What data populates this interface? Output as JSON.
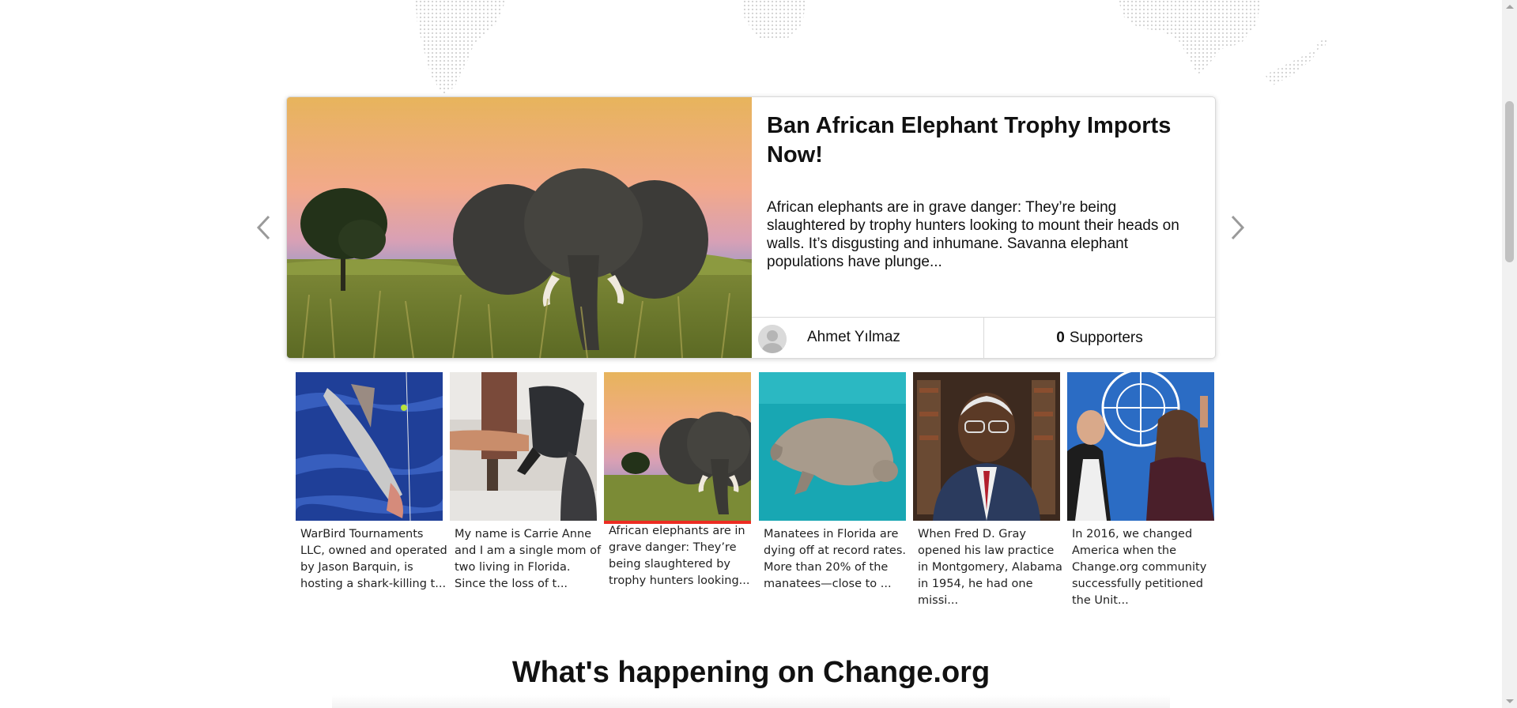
{
  "featured": {
    "title": "Ban African Elephant Trophy Imports Now!",
    "description": "African elephants are in grave danger: They’re being slaughtered by trophy hunters looking to mount their heads on walls. It’s disgusting and inhumane. Savanna elephant populations have plunge...",
    "author": "Ahmet Yılmaz",
    "supporters_count": "0",
    "supporters_label": "Supporters"
  },
  "thumbnails": [
    {
      "text": "WarBird Tournaments LLC, owned and operated by Jason Barquin, is hosting a shark-killing t...",
      "image": "shark-photo"
    },
    {
      "text": "My name is Carrie Anne and I am a single mom of two living in Florida. Since the loss of t...",
      "image": "gas-pump-photo"
    },
    {
      "text": "African elephants are in grave danger: They’re being slaughtered by trophy hunters looking...",
      "image": "elephant-photo",
      "active": true
    },
    {
      "text": "Manatees in Florida are dying off at record rates. More than 20% of the manatees—close to ...",
      "image": "manatee-photo"
    },
    {
      "text": "When Fred D. Gray opened his law practice in Montgomery, Alabama in 1954, he had one missi...",
      "image": "fred-gray-photo"
    },
    {
      "text": "In 2016, we changed America when the Change.org community successfully petitioned the Unit...",
      "image": "un-women-photo"
    }
  ],
  "section_heading": "What's happening on Change.org",
  "icons": {
    "prev": "chevron-left-icon",
    "next": "chevron-right-icon",
    "avatar": "user-avatar-icon"
  },
  "colors": {
    "active_indicator": "#ec2c22",
    "text": "#111111"
  }
}
